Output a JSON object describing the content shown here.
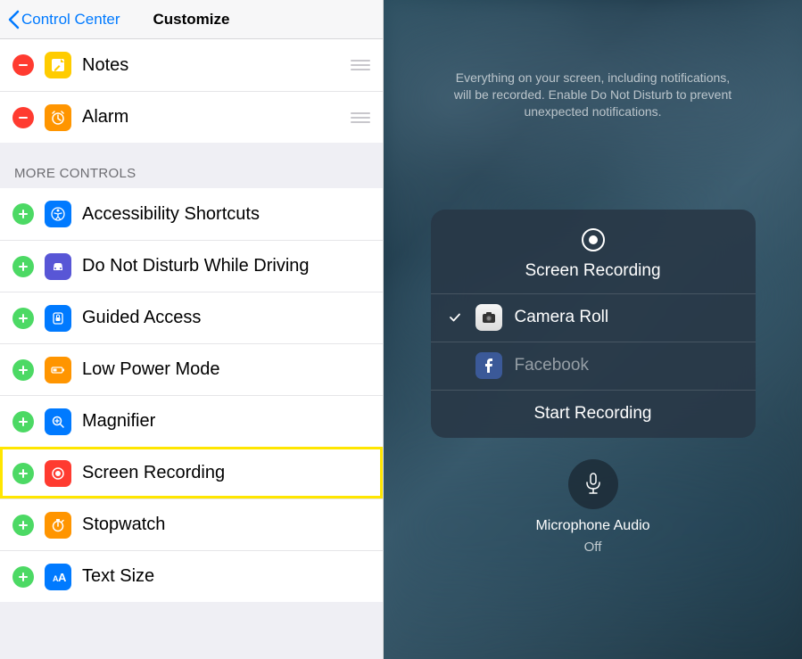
{
  "nav": {
    "back_label": "Control Center",
    "title": "Customize"
  },
  "included": [
    {
      "label": "Notes",
      "icon": "notes",
      "icon_bg": "#ffcc00",
      "draggable": true
    },
    {
      "label": "Alarm",
      "icon": "alarm",
      "icon_bg": "#ff9500",
      "draggable": true
    }
  ],
  "more_header": "MORE CONTROLS",
  "more": [
    {
      "label": "Accessibility Shortcuts",
      "icon": "accessibility",
      "icon_bg": "#007aff"
    },
    {
      "label": "Do Not Disturb While Driving",
      "icon": "car",
      "icon_bg": "#5856d6"
    },
    {
      "label": "Guided Access",
      "icon": "lock",
      "icon_bg": "#007aff"
    },
    {
      "label": "Low Power Mode",
      "icon": "battery",
      "icon_bg": "#ff9500"
    },
    {
      "label": "Magnifier",
      "icon": "magnifier",
      "icon_bg": "#007aff"
    },
    {
      "label": "Screen Recording",
      "icon": "record",
      "icon_bg": "#ff3b30",
      "highlighted": true
    },
    {
      "label": "Stopwatch",
      "icon": "stopwatch",
      "icon_bg": "#ff9500"
    },
    {
      "label": "Text Size",
      "icon": "text-size",
      "icon_bg": "#007aff"
    }
  ],
  "overlay": {
    "notice": "Everything on your screen, including notifications, will be recorded. Enable Do Not Disturb to prevent unexpected notifications.",
    "title": "Screen Recording",
    "options": [
      {
        "label": "Camera Roll",
        "icon": "camera",
        "icon_bg": "#e5e5ea",
        "selected": true
      },
      {
        "label": "Facebook",
        "icon": "facebook",
        "icon_bg": "#3b5998",
        "selected": false
      }
    ],
    "action": "Start Recording",
    "mic_label": "Microphone Audio",
    "mic_state": "Off"
  }
}
